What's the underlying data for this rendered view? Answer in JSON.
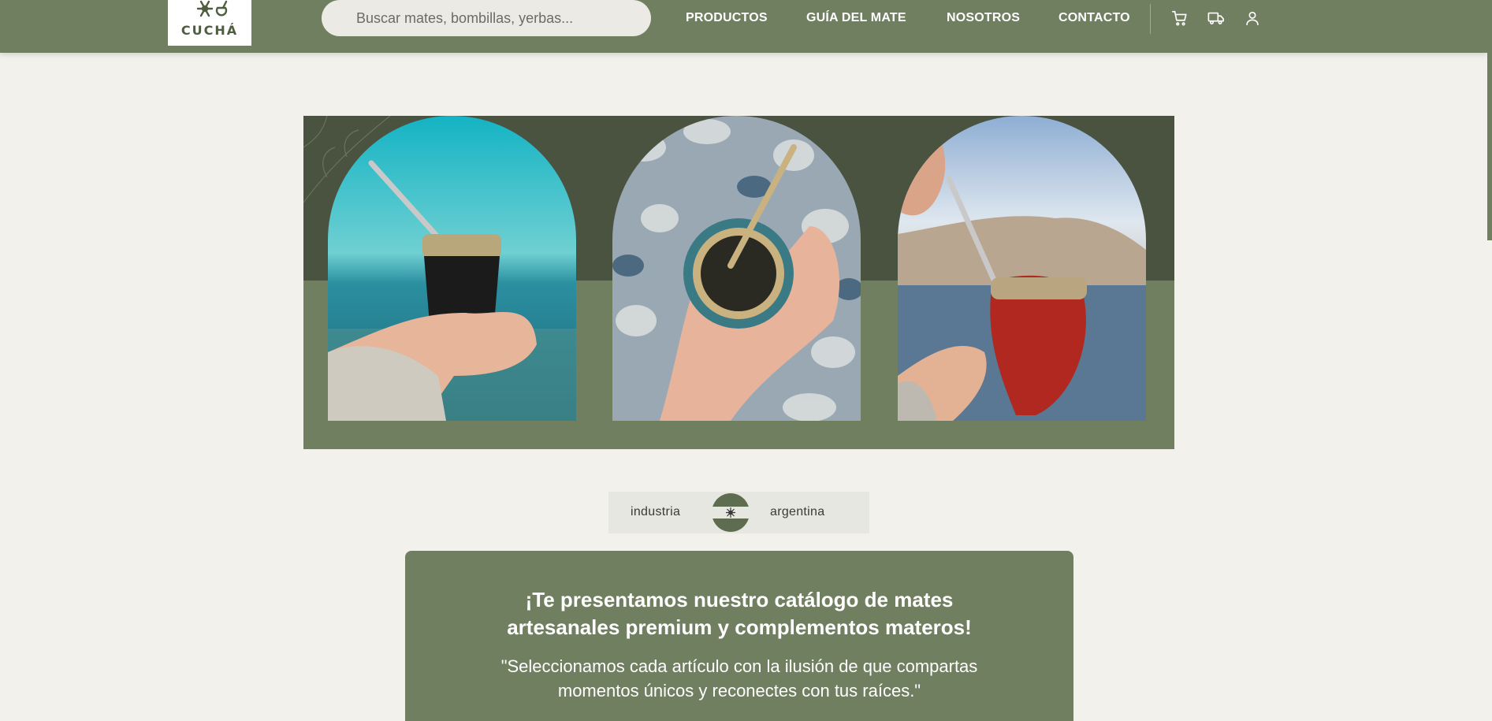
{
  "header": {
    "logo_text": "CUCHÁ",
    "search_placeholder": "Buscar mates, bombillas, yerbas...",
    "nav": [
      {
        "label": "PRODUCTOS"
      },
      {
        "label": "GUÍA DEL MATE"
      },
      {
        "label": "NOSOTROS"
      },
      {
        "label": "CONTACTO"
      }
    ],
    "icons": [
      "cart-icon",
      "truck-icon",
      "user-icon"
    ]
  },
  "hero": {
    "images": [
      {
        "subject": "mate-by-the-sea"
      },
      {
        "subject": "mate-from-above-on-pebbles"
      },
      {
        "subject": "red-mate-at-coast"
      }
    ]
  },
  "badge": {
    "left_text": "industria",
    "right_text": "argentina"
  },
  "catalog": {
    "title_line1": "¡Te presentamos nuestro catálogo de mates",
    "title_line2": "artesanales premium y complementos materos!",
    "quote_line1": "\"Seleccionamos cada artículo con la ilusión de que compartas",
    "quote_line2": "momentos únicos y reconectes con tus raíces.\""
  },
  "colors": {
    "brand_green": "#717f61",
    "dark_green": "#4a5240",
    "background": "#f3f1ec"
  }
}
